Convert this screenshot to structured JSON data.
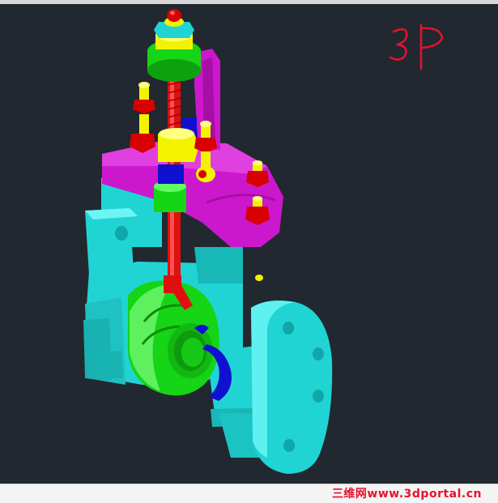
{
  "viewport": {
    "annotation_text": "3P",
    "annotation_color": "#e8112d",
    "background": "#212830"
  },
  "model": {
    "colors": {
      "body": "#21d4d4",
      "bonnet": "#cc18cc",
      "ball": "#16d416",
      "stem": "#e01010",
      "seat": "#1010d0",
      "fastener": "#f3f300",
      "nut": "#d80000"
    }
  },
  "footer": {
    "watermark": "三维网www.3dportal.cn"
  }
}
